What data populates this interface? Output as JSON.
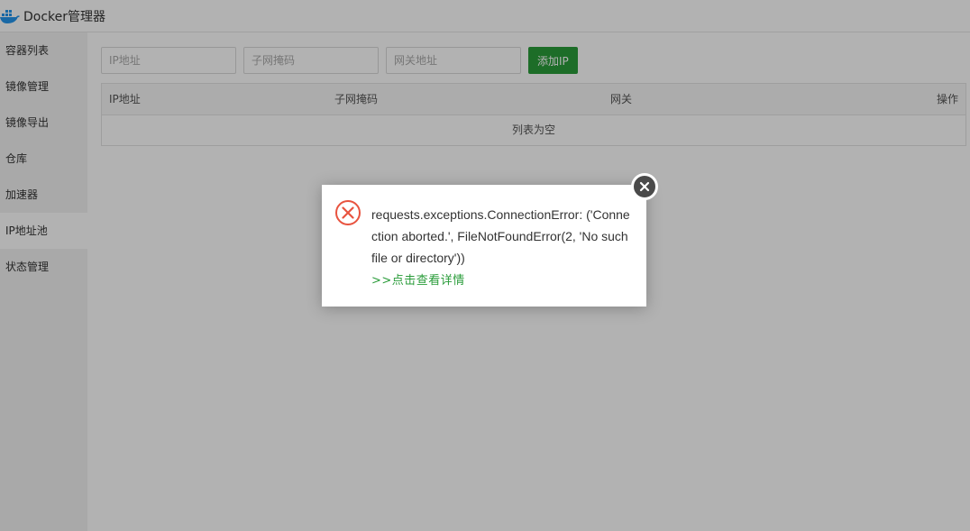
{
  "app": {
    "title": "Docker管理器",
    "logo_icon": "docker-whale-icon"
  },
  "sidebar": {
    "items": [
      {
        "label": "容器列表",
        "active": false
      },
      {
        "label": "镜像管理",
        "active": false
      },
      {
        "label": "镜像导出",
        "active": false
      },
      {
        "label": "仓库",
        "active": false
      },
      {
        "label": "加速器",
        "active": false
      },
      {
        "label": "IP地址池",
        "active": true
      },
      {
        "label": "状态管理",
        "active": false
      }
    ]
  },
  "form": {
    "ip_placeholder": "IP地址",
    "mask_placeholder": "子网掩码",
    "gateway_placeholder": "网关地址",
    "add_button": "添加IP",
    "add_button_color": "#2a9c3a"
  },
  "table": {
    "headers": [
      "IP地址",
      "子网掩码",
      "网关",
      "操作"
    ],
    "empty_text": "列表为空"
  },
  "dialog": {
    "icon": "error-circle-icon",
    "icon_color": "#e8533f",
    "message": "requests.exceptions.ConnectionError: ('Connection aborted.', FileNotFoundError(2, 'No such file or directory'))",
    "link": ">>点击查看详情",
    "link_color": "#2a9c3a",
    "close_icon": "close-icon"
  }
}
